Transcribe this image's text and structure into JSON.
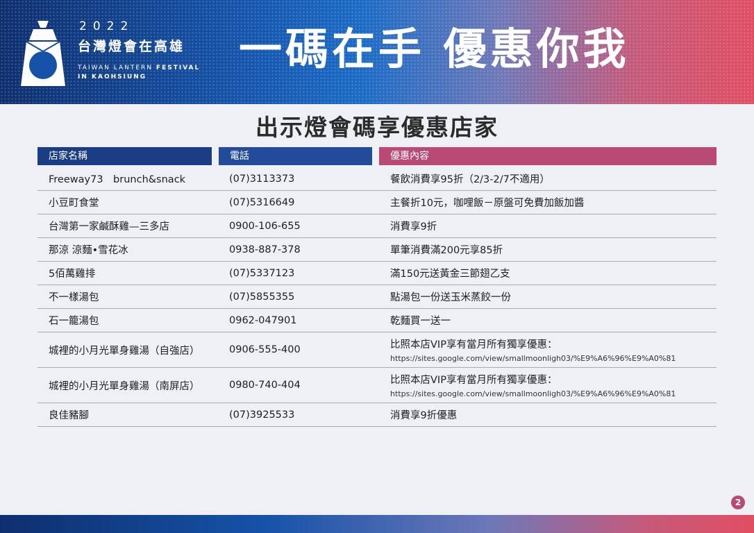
{
  "colors": {
    "header_blue_dark": "#1a3d86",
    "header_blue": "#224b9a",
    "header_pink": "#b84a74",
    "banner_left": "#0e2f6e",
    "banner_right": "#e04e62"
  },
  "logo": {
    "icon": "lantern-logo-icon",
    "year": "2022",
    "title": "台灣燈會在高雄",
    "en_line1_a": "TAIWAN LANTERN ",
    "en_line1_b": "FESTIVAL",
    "en_line2": "IN KAOHSIUNG"
  },
  "headline": "一碼在手 優惠你我",
  "subtitle": "出示燈會碼享優惠店家",
  "table": {
    "headers": {
      "name": "店家名稱",
      "phone": "電話",
      "offer": "優惠內容"
    },
    "rows": [
      {
        "name": "Freeway73　brunch&snack",
        "phone": "(07)3113373",
        "offer": "餐飲消費享95折（2/3-2/7不適用）",
        "url": ""
      },
      {
        "name": "小豆町食堂",
        "phone": "(07)5316649",
        "offer": "主餐折10元，咖哩飯－原盤可免費加飯加醬",
        "url": ""
      },
      {
        "name": "台灣第一家鹹酥雞—三多店",
        "phone": "0900-106-655",
        "offer": "消費享9折",
        "url": ""
      },
      {
        "name": "那涼 涼麵•雪花冰",
        "phone": "0938-887-378",
        "offer": "單筆消費滿200元享85折",
        "url": ""
      },
      {
        "name": "5佰萬雞排",
        "phone": "(07)5337123",
        "offer": "滿150元送黃金三節翅乙支",
        "url": ""
      },
      {
        "name": "不一樣湯包",
        "phone": "(07)5855355",
        "offer": "點湯包一份送玉米蒸餃一份",
        "url": ""
      },
      {
        "name": "石一籠湯包",
        "phone": "0962-047901",
        "offer": "乾麵買一送一",
        "url": ""
      },
      {
        "name": "城裡的小月光單身雞湯（自強店）",
        "phone": "0906-555-400",
        "offer": "比照本店VIP享有當月所有獨享優惠：",
        "url": "https://sites.google.com/view/smallmoonligh03/%E9%A6%96%E9%A0%81"
      },
      {
        "name": "城裡的小月光單身雞湯（南屏店）",
        "phone": "0980-740-404",
        "offer": "比照本店VIP享有當月所有獨享優惠：",
        "url": "https://sites.google.com/view/smallmoonligh03/%E9%A6%96%E9%A0%81"
      },
      {
        "name": "良佳豬腳",
        "phone": "(07)3925533",
        "offer": "消費享9折優惠",
        "url": ""
      }
    ]
  },
  "page_number": "2"
}
